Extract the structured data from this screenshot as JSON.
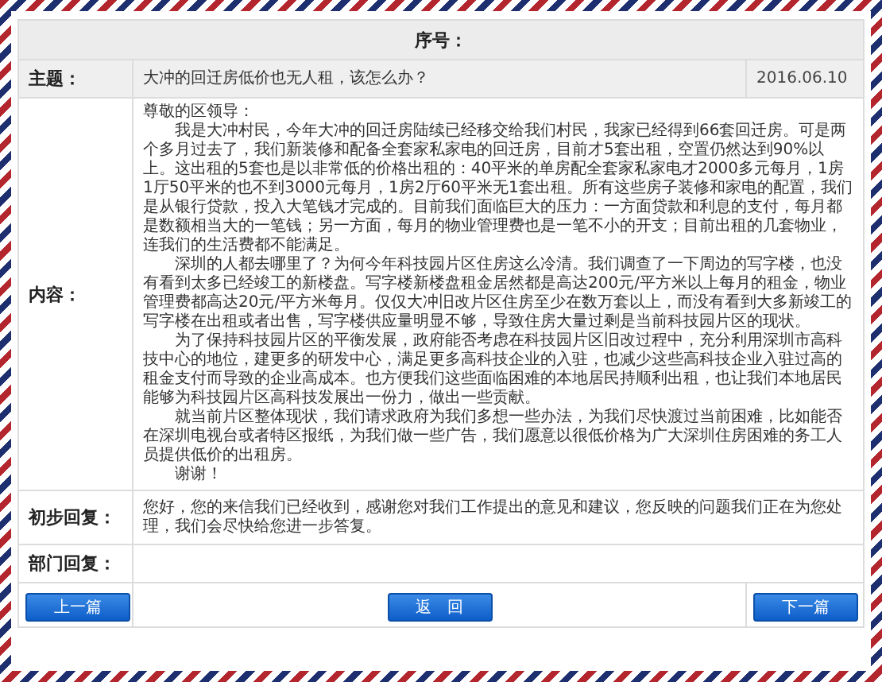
{
  "header": {
    "label": "序号："
  },
  "subject": {
    "label": "主题：",
    "title": "大冲的回迁房低价也无人租，该怎么办？",
    "date": "2016.06.10"
  },
  "content": {
    "label": "内容：",
    "salutation": "尊敬的区领导：",
    "paragraphs": [
      "我是大冲村民，今年大冲的回迁房陆续已经移交给我们村民，我家已经得到66套回迁房。可是两个多月过去了，我们新装修和配备全套家私家电的回迁房，目前才5套出租，空置仍然达到90%以上。这出租的5套也是以非常低的价格出租的：40平米的单房配全套家私家电才2000多元每月，1房1厅50平米的也不到3000元每月，1房2厅60平米无1套出租。所有这些房子装修和家电的配置，我们是从银行贷款，投入大笔钱才完成的。目前我们面临巨大的压力：一方面贷款和利息的支付，每月都是数额相当大的一笔钱；另一方面，每月的物业管理费也是一笔不小的开支；目前出租的几套物业，连我们的生活费都不能满足。",
      "深圳的人都去哪里了？为何今年科技园片区住房这么冷清。我们调查了一下周边的写字楼，也没有看到太多已经竣工的新楼盘。写字楼新楼盘租金居然都是高达200元/平方米以上每月的租金，物业管理费都高达20元/平方米每月。仅仅大冲旧改片区住房至少在数万套以上，而没有看到大多新竣工的写字楼在出租或者出售，写字楼供应量明显不够，导致住房大量过剩是当前科技园片区的现状。",
      "为了保持科技园片区的平衡发展，政府能否考虑在科技园片区旧改过程中，充分利用深圳市高科技中心的地位，建更多的研发中心，满足更多高科技企业的入驻，也减少这些高科技企业入驻过高的租金支付而导致的企业高成本。也方便我们这些面临困难的本地居民持顺利出租，也让我们本地居民能够为科技园片区高科技发展出一份力，做出一些贡献。",
      "就当前片区整体现状，我们请求政府为我们多想一些办法，为我们尽快渡过当前困难，比如能否在深圳电视台或者特区报纸，为我们做一些广告，我们愿意以很低价格为广大深圳住房困难的务工人员提供低价的出租房。"
    ],
    "closing": "谢谢！"
  },
  "initial_reply": {
    "label": "初步回复：",
    "text": "您好，您的来信我们已经收到，感谢您对我们工作提出的意见和建议，您反映的问题我们正在为您处理，我们会尽快给您进一步答复。"
  },
  "department_reply": {
    "label": "部门回复："
  },
  "buttons": [
    {
      "label": "上一篇"
    },
    {
      "label": "返　回"
    },
    {
      "label": "下一篇"
    }
  ]
}
